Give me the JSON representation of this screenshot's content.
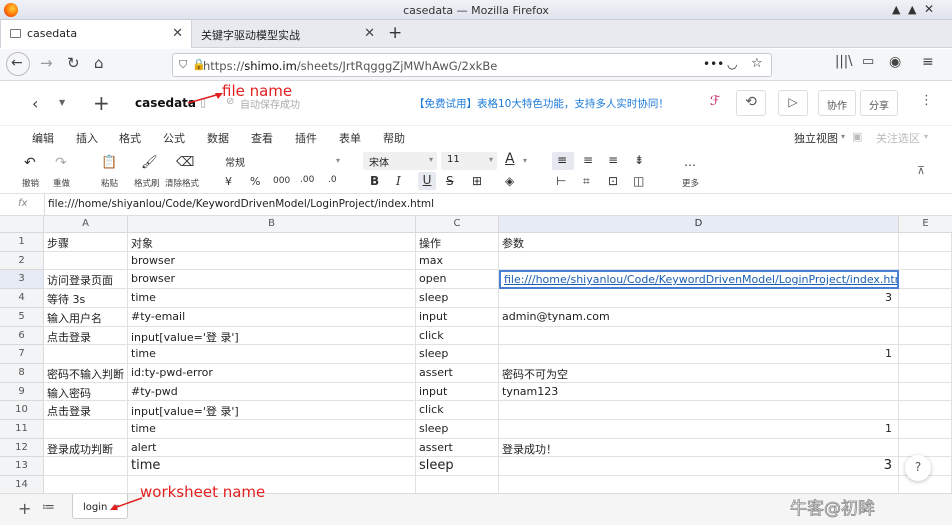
{
  "window": {
    "title": "casedata — Mozilla Firefox",
    "controls": "▲ ▲ ✕"
  },
  "tabs": [
    {
      "label": "casedata"
    },
    {
      "label": "关键字驱动模型实战"
    }
  ],
  "url": {
    "prefix": "https://",
    "host": "shimo.im",
    "path": "/sheets/JrtRqgggZjMWhAwG/2xkBe"
  },
  "app": {
    "doc_title": "casedata",
    "save_status": "自动保存成功",
    "promo": "【免费试用】表格10大特色功能，支持多人实时协同！",
    "collab": "协作",
    "share": "分享"
  },
  "menu": [
    "编辑",
    "插入",
    "格式",
    "公式",
    "数据",
    "查看",
    "插件",
    "表单",
    "帮助"
  ],
  "menu_right": {
    "view": "独立视图",
    "filter": "关注选区"
  },
  "toolbar": {
    "undo": "撤销",
    "redo": "重做",
    "paste": "粘贴",
    "format_painter": "格式刷",
    "clear_format": "清除格式",
    "number_format": "常规",
    "font": "宋体",
    "font_size": "11",
    "more": "更多"
  },
  "formula": {
    "label": "fx",
    "value": "file:///home/shiyanlou/Code/KeywordDrivenModel/LoginProject/index.html"
  },
  "columns": [
    "A",
    "B",
    "C",
    "D",
    "E"
  ],
  "rows": [
    {
      "n": "1",
      "a": "步骤",
      "b": "对象",
      "c": "操作",
      "d": ""
    },
    {
      "n": "2",
      "a": "",
      "b": "browser",
      "c": "max",
      "d": ""
    },
    {
      "n": "3",
      "a": "访问登录页面",
      "b": "browser",
      "c": "open",
      "d": "file:///home/shiyanlou/Code/KeywordDrivenModel/LoginProject/index.htm"
    },
    {
      "n": "4",
      "a": "等待 3s",
      "b": "time",
      "c": "sleep",
      "d": "3"
    },
    {
      "n": "5",
      "a": "输入用户名",
      "b": "#ty-email",
      "c": "input",
      "d": "admin@tynam.com"
    },
    {
      "n": "6",
      "a": "点击登录",
      "b": "input[value='登  录']",
      "c": "click",
      "d": ""
    },
    {
      "n": "7",
      "a": "",
      "b": "time",
      "c": "sleep",
      "d": "1"
    },
    {
      "n": "8",
      "a": "密码不输入判断",
      "b": "id:ty-pwd-error",
      "c": "assert",
      "d": "密码不可为空"
    },
    {
      "n": "9",
      "a": "输入密码",
      "b": "#ty-pwd",
      "c": "input",
      "d": "tynam123"
    },
    {
      "n": "10",
      "a": "点击登录",
      "b": "input[value='登  录']",
      "c": "click",
      "d": ""
    },
    {
      "n": "11",
      "a": "",
      "b": "time",
      "c": "sleep",
      "d": "1"
    },
    {
      "n": "12",
      "a": "登录成功判断",
      "b": "alert",
      "c": "assert",
      "d": "登录成功！"
    },
    {
      "n": "13",
      "a": "",
      "b": "time",
      "c": "sleep",
      "d": "3"
    },
    {
      "n": "14",
      "a": "",
      "b": "",
      "c": "",
      "d": ""
    }
  ],
  "header_d1": "参数",
  "sheet": {
    "name": "login"
  },
  "annotations": {
    "file": "file name",
    "worksheet": "worksheet name"
  },
  "watermark": "牛客@初眸",
  "colors": {
    "accent": "#1a5fb4",
    "annotation": "#e41f1f"
  }
}
